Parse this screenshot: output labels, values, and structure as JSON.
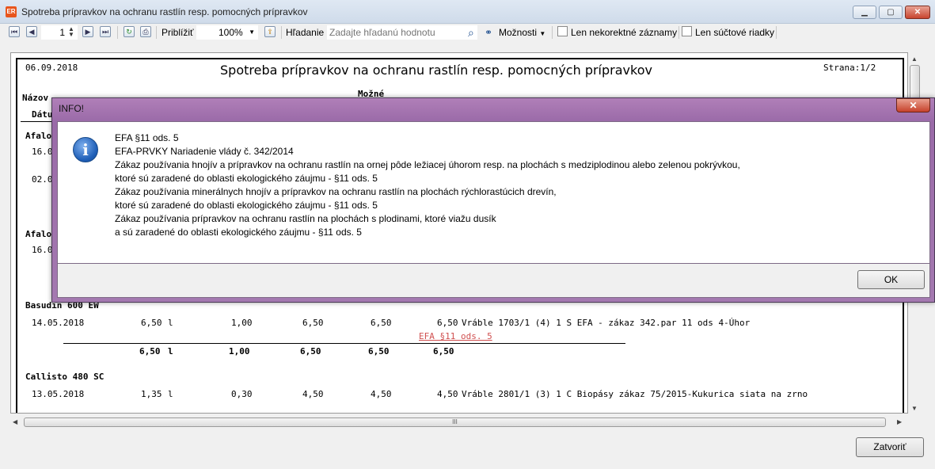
{
  "window": {
    "icon_text": "ER",
    "title": "Spotreba prípravkov na ochranu rastlín resp. pomocných prípravkov",
    "min_icon": "minimize-icon",
    "max_icon": "maximize-icon",
    "close_glyph": "✕"
  },
  "toolbar": {
    "first_glyph": "⏮",
    "prev_glyph": "◀",
    "page_value": "1",
    "next_glyph": "▶",
    "last_glyph": "⏭",
    "refresh_glyph": "↻",
    "print_glyph": "⎙",
    "zoom_label": "Priblížiť",
    "zoom_value": "100%",
    "export_glyph": "⇪",
    "search_label": "Hľadanie",
    "search_placeholder": "Zadajte hľadanú hodnotu",
    "search_glyph": "⌕",
    "options_glyph": "⚭",
    "options_label": "Možnosti",
    "only_incorrect_label": "Len nekorektné záznamy",
    "only_sum_label": "Len súčtové riadky"
  },
  "report": {
    "date": "06.09.2018",
    "title": "Spotreba prípravkov na ochranu rastlín resp. pomocných prípravkov",
    "page": "Strana:1/2",
    "header_name": "Názov",
    "header_mozne": "Možné",
    "header_datum": "Dátu",
    "group1_name": "Afalo",
    "group1_row1_date": "16.0",
    "group1_row2_date": "02.0",
    "group2_name": "Afalo",
    "group2_row1_date": "16.0",
    "basudin": {
      "name": "Basudin 600 EW",
      "row": [
        "14.05.2018",
        "6,50",
        "l",
        "1,00",
        "6,50",
        "6,50",
        "6,50",
        "Vráble 1703/1 (4) 1 S EFA - zákaz 342.par 11 ods 4-Úhor"
      ],
      "link": "EFA §11 ods. 5",
      "totals": [
        "6,50",
        "l",
        "1,00",
        "6,50",
        "6,50",
        "6,50"
      ]
    },
    "callisto": {
      "name": "Callisto 480 SC",
      "row": [
        "13.05.2018",
        "1,35",
        "l",
        "0,30",
        "4,50",
        "4,50",
        "4,50",
        "Vráble 2801/1 (3) 1 C Biopásy zákaz 75/2015-Kukurica siata na zrno"
      ]
    }
  },
  "dialog": {
    "title": "INFO!",
    "close_glyph": "✕",
    "icon_letter": "i",
    "lines": [
      "EFA §11 ods. 5",
      "EFA-PRVKY Nariadenie vlády č. 342/2014",
      "Zákaz používania hnojív a prípravkov na ochranu rastlín na ornej pôde ležiacej úhorom resp. na plochách s medziplodinou alebo zelenou pokrývkou,",
      "ktoré sú zaradené do oblasti ekologického záujmu - §11 ods. 5",
      "Zákaz používania minerálnych hnojív a prípravkov na ochranu rastlín na plochách rýchlorastúcich drevín,",
      "ktoré sú zaradené do oblasti ekologického záujmu - §11 ods. 5",
      "Zákaz používania prípravkov na ochranu rastlín na plochách s plodinami, ktoré viažu dusík",
      "a sú zaradené do oblasti ekologického záujmu - §11 ods. 5"
    ],
    "ok_label": "OK"
  },
  "footer": {
    "close_label": "Zatvoriť",
    "hscroll_grip": "III"
  }
}
